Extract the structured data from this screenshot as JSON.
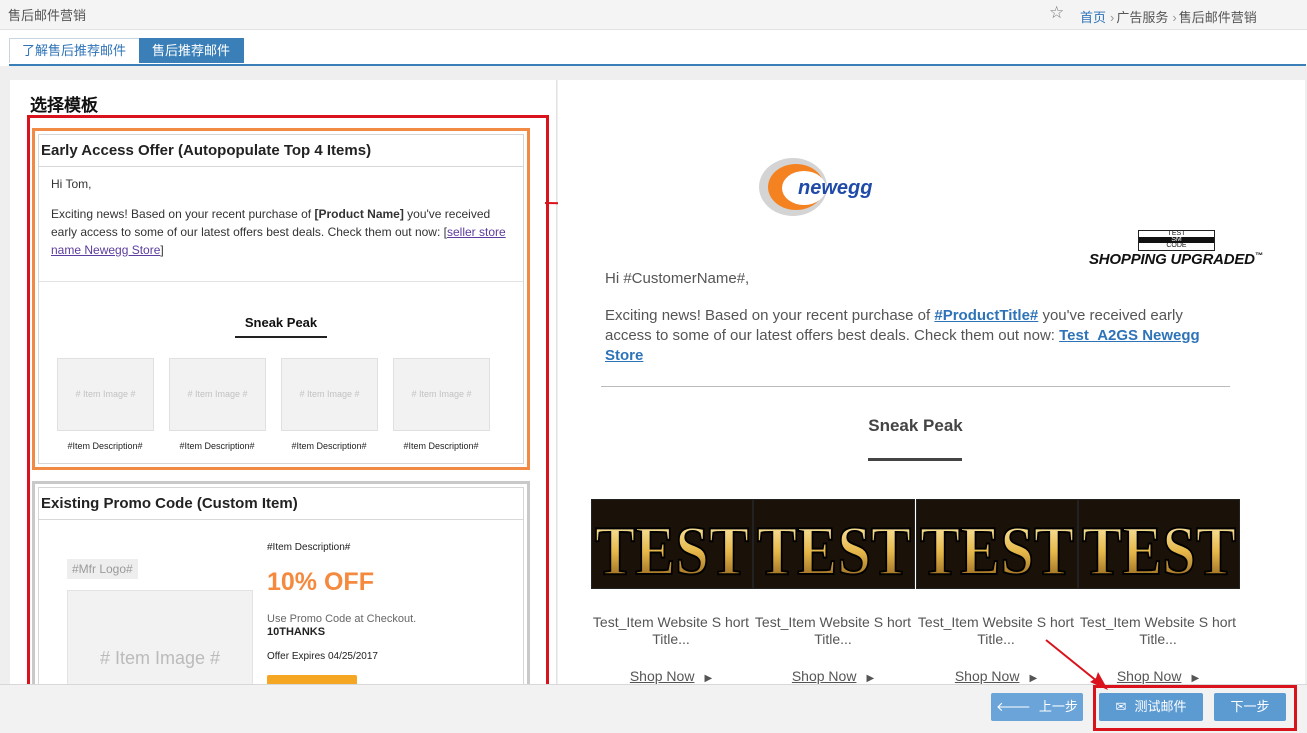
{
  "header": {
    "page_title": "售后邮件营销",
    "breadcrumb": {
      "home": "首页",
      "level2": "广告服务",
      "level3": "售后邮件营销"
    }
  },
  "tabs": [
    {
      "label": "了解售后推荐邮件",
      "active": false
    },
    {
      "label": "售后推荐邮件",
      "active": true
    }
  ],
  "left_panel": {
    "title": "选择模板",
    "templates": [
      {
        "title": "Early Access Offer (Autopopulate Top 4 Items)",
        "greeting": "Hi Tom,",
        "body_prefix": "Exciting news! Based on your recent purchase of ",
        "product_name": "[Product Name]",
        "body_mid": " you've received early access to some of our latest offers best deals. Check them out now: ",
        "bracket_open": "[",
        "store_link": "seller store name Newegg Store",
        "bracket_close": "]",
        "sneak_heading": "Sneak Peak",
        "items": [
          {
            "image": "# Item Image #",
            "desc": "#Item Description#"
          },
          {
            "image": "# Item Image #",
            "desc": "#Item Description#"
          },
          {
            "image": "# Item Image #",
            "desc": "#Item Description#"
          },
          {
            "image": "# Item Image #",
            "desc": "#Item Description#"
          }
        ]
      },
      {
        "title": "Existing Promo Code (Custom Item)",
        "mfr_logo": "#Mfr Logo#",
        "item_image": "# Item Image #",
        "item_desc": "#Item Description#",
        "offer": "10% OFF",
        "promo_label": "Use Promo Code at Checkout.",
        "promo_code": "10THANKS",
        "expires": "Offer Expires 04/25/2017"
      }
    ]
  },
  "preview": {
    "brand": "newegg",
    "tagline": "SHOPPING UPGRADED",
    "tagline_tm": "™",
    "badge_lines": [
      "TEST",
      "SM",
      "CODE"
    ],
    "greeting": "Hi #CustomerName#,",
    "body_prefix": "Exciting news! Based on your recent purchase of ",
    "product_title": "#ProductTitle#",
    "body_mid": " you've received early access to some of our latest offers best deals. Check them out now: ",
    "store_link": "Test_A2GS Newegg Store",
    "sneak_heading": "Sneak Peak",
    "products": [
      {
        "image_text": "TEST",
        "title": "Test_Item Website S hort Title...",
        "cta": "Shop Now"
      },
      {
        "image_text": "TEST",
        "title": "Test_Item Website S hort Title...",
        "cta": "Shop Now"
      },
      {
        "image_text": "TEST",
        "title": "Test_Item Website S hort Title...",
        "cta": "Shop Now"
      },
      {
        "image_text": "TEST",
        "title": "Test_Item Website S hort Title...",
        "cta": "Shop Now"
      }
    ]
  },
  "footer": {
    "prev_label": "上一步",
    "test_label": "测试邮件",
    "next_label": "下一步"
  },
  "colors": {
    "accent_blue": "#3a7fb8",
    "button_blue": "#5c9ad2",
    "highlight_red": "#d9121b",
    "selected_orange": "#f08a44",
    "offer_orange": "#f58a3e"
  },
  "icons": {
    "star": "star-icon",
    "prev": "arrow-left-icon",
    "test": "envelope-icon",
    "shop": "triangle-right-icon"
  }
}
